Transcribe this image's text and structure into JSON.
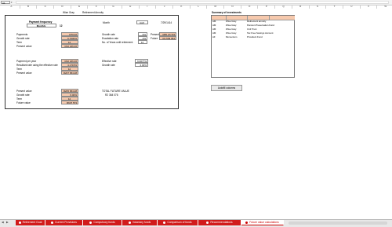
{
  "formula_bar": {
    "name_box": "A1",
    "formula": ""
  },
  "columns": [
    "A",
    "B",
    "C",
    "D",
    "E",
    "F",
    "G",
    "H",
    "I",
    "J",
    "K",
    "L",
    "M",
    "N",
    "O",
    "P",
    "Q",
    "R",
    "S",
    "T",
    "U",
    "V",
    "W"
  ],
  "header": {
    "company": "Wise Gray",
    "section": "Retirement Annuity"
  },
  "calc": {
    "payment_frequency_label": "Payment frequency",
    "payment_frequency_value": "Monthly",
    "payment_frequency_num": "12",
    "month_label": "Month",
    "month_value": "April",
    "date_value": "7/29/1414",
    "payments_label": "Payments",
    "payments_value": "R70.02",
    "growth_rate_label": "Growth rate",
    "growth_rate_value": "6.7000%",
    "term_label": "Term",
    "term_value": "12",
    "present_value_label": "Present value",
    "present_value_value": "R32 226.46",
    "growth_rate2_label": "Growth rate",
    "growth_rate2_value": "6%",
    "escalation_label": "Escalation rate",
    "escalation_value": "2%",
    "years_label": "No. of Years until retirement",
    "years_value": "12",
    "present_label": "Present",
    "present_value2": "R85 277.83",
    "future_label": "Future",
    "future_value": "R1 539 064",
    "payment_per_year_label": "Payment per year",
    "payment_per_year_value": "R32 226.46",
    "resultant_rate_label": "Resultant rate using the effective rate",
    "resultant_rate_value": "4.1715%",
    "term2_label": "Term",
    "term2_value": "12",
    "present_value3_label": "Present value",
    "present_value3_value": "R207 954.28",
    "effective_rate_label": "Effective rate",
    "effective_rate_value": "6.9677%",
    "growth_rate3_label": "Growth rate",
    "growth_rate3_value": "2.00%",
    "present_value4_label": "Present value",
    "present_value4_value": "R205 954.28",
    "growth_rate4_label": "Growth rate",
    "growth_rate4_value": "6.00%",
    "term3_label": "Term",
    "term3_value": "12",
    "future_value_label": "Future value",
    "future_value_value": "R637 573",
    "total_label": "TOTAL FUTURE VALUE",
    "total_value": "R2 364 076"
  },
  "summary": {
    "title": "Summary of investments",
    "rows": [
      {
        "code": "AM",
        "holder": "Wise Gray",
        "product": "Retirement annuity"
      },
      {
        "code": "AM",
        "holder": "Wise Gray",
        "product": "Pension Preservation Fund"
      },
      {
        "code": "AM",
        "holder": "Wise Gray",
        "product": "Unit Trust"
      },
      {
        "code": "AM",
        "holder": "Wise Gray",
        "product": "Tax Free Savings Account"
      },
      {
        "code": "AF",
        "holder": "Momentum",
        "product": "Provident Fund"
      }
    ]
  },
  "autofill_button": "Autofill columns",
  "tabs": [
    {
      "label": "Retirement Goal",
      "active": false
    },
    {
      "label": "Current Provisions",
      "active": false
    },
    {
      "label": "Compulsory funds",
      "active": false
    },
    {
      "label": "Voluntary funds",
      "active": false
    },
    {
      "label": "Comparison of funds",
      "active": false
    },
    {
      "label": "Recommendations",
      "active": false
    },
    {
      "label": "Future value calculations",
      "active": true
    }
  ],
  "colors": {
    "tab_red": "#d11b1b",
    "peach": "#f6c9ad",
    "header_peach": "#f6c9ad"
  }
}
